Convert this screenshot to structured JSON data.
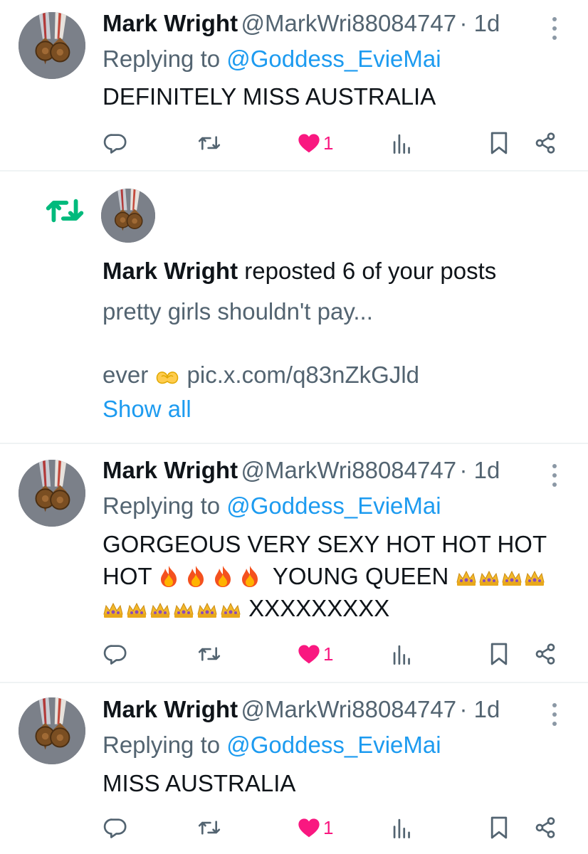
{
  "posts": [
    {
      "name": "Mark Wright",
      "handle": "@MarkWri88084747",
      "time": "· 1d",
      "replying_prefix": "Replying to ",
      "replying_handle": "@Goddess_EvieMai",
      "text_lines": [
        "DEFINITELY MISS AUSTRALIA"
      ],
      "like_count": "1"
    },
    {
      "name": "Mark Wright",
      "handle": "@MarkWri88084747",
      "time": "· 1d",
      "replying_prefix": "Replying to ",
      "replying_handle": "@Goddess_EvieMai",
      "text_line1": "GORGEOUS VERY SEXY HOT HOT HOT",
      "text_line2_a": "HOT",
      "text_line2_b": "YOUNG QUEEN",
      "text_line3": "XXXXXXXXX",
      "like_count": "1"
    },
    {
      "name": "Mark Wright",
      "handle": "@MarkWri88084747",
      "time": "· 1d",
      "replying_prefix": "Replying to ",
      "replying_handle": "@Goddess_EvieMai",
      "text_lines": [
        "MISS AUSTRALIA"
      ],
      "like_count": "1"
    }
  ],
  "repost_notification": {
    "name": "Mark Wright",
    "action_text": " reposted 6 of your posts",
    "preview_line1": "pretty girls shouldn't pay...",
    "preview_line2_a": "ever",
    "preview_line2_b": " pic.x.com/q83nZkGJld",
    "show_all": "Show all"
  },
  "colors": {
    "like": "#f91880",
    "repost_green": "#00ba7c",
    "link_blue": "#1d9bf0",
    "secondary_text": "#536471"
  },
  "icons": [
    "reply-icon",
    "repost-icon",
    "like-icon",
    "views-icon",
    "bookmark-icon",
    "share-icon",
    "more-icon",
    "fire-emoji",
    "crown-emoji",
    "heart-hands-emoji"
  ]
}
